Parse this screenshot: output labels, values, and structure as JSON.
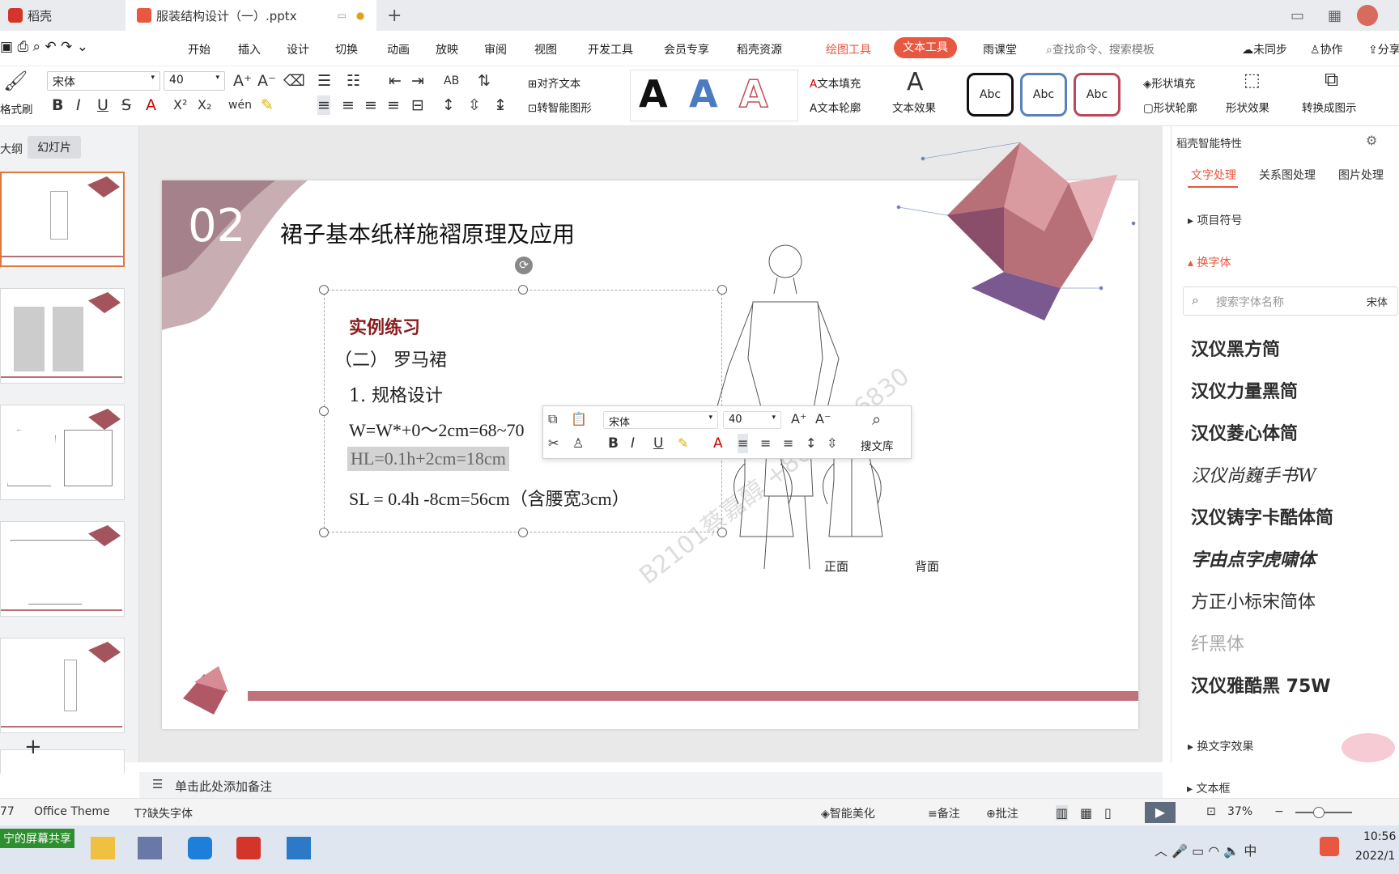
{
  "colors": {
    "accent": "#e8573f",
    "brand": "#d4342a",
    "wine": "#8a1c1c",
    "rose": "#b5676f"
  },
  "tabs": {
    "home": "稻壳",
    "doc": "服装结构设计（一）.pptx"
  },
  "menu": {
    "items": [
      "开始",
      "插入",
      "设计",
      "切换",
      "动画",
      "放映",
      "审阅",
      "视图",
      "开发工具",
      "会员专享",
      "稻壳资源"
    ],
    "draw_tools": "绘图工具",
    "text_tools": "文本工具",
    "rain": "雨课堂",
    "search": "查找命令、搜索模板",
    "unsync": "未同步",
    "collab": "协作",
    "share": "分享"
  },
  "ribbon": {
    "format_brush": "格式刷",
    "font": "宋体",
    "size": "40",
    "align_text": "对齐文本",
    "smart": "转智能图形",
    "fill": "文本填充",
    "outline": "文本轮廓",
    "effect": "文本效果",
    "shape_fill": "形状填充",
    "shape_outline": "形状轮廓",
    "shape_effect": "形状效果",
    "convert": "转换成图示",
    "abc": "Abc",
    "big_a": "A"
  },
  "panel_tabs": {
    "outline": "大纲",
    "slides": "幻灯片"
  },
  "slide": {
    "number": "02",
    "title": "裙子基本纸样施褶原理及应用",
    "h": "实例练习",
    "sub": "（二） 罗马裙",
    "l1": "1. 规格设计",
    "l2": "W=W*+0～2cm=68~70",
    "l3": "HL=0.1h+2cm=18cm",
    "l4": "SL = 0.4h -8cm=56cm（含腰宽3cm）",
    "front": "正面",
    "back": "背面",
    "watermark": "B2101蔡嘉醇 +8618256830"
  },
  "mini": {
    "font": "宋体",
    "size": "40",
    "lib": "搜文库"
  },
  "notes": "单击此处添加备注",
  "right": {
    "title": "稻壳智能特性",
    "tabs": [
      "文字处理",
      "关系图处理",
      "图片处理"
    ],
    "bullets": "项目符号",
    "change_font": "换字体",
    "search": "搜索字体名称",
    "font_now": "宋体",
    "fonts": [
      "汉仪黑方简",
      "汉仪力量黑简",
      "汉仪菱心体简",
      "汉仪尚巍手书W",
      "汉仪铸字卡酷体简",
      "字由点字虎啸体",
      "方正小标宋简体",
      "纤黑体",
      "汉仪雅酷黑 75W"
    ],
    "effects": "换文字效果",
    "textbox": "文本框"
  },
  "status": {
    "page": "77",
    "theme": "Office Theme",
    "missing": "缺失字体",
    "beautify": "智能美化",
    "notes": "备注",
    "comment": "批注",
    "zoom": "37%"
  },
  "taskbar": {
    "share": "宁的屏幕共享",
    "time": "10:56",
    "date": "2022/1"
  }
}
